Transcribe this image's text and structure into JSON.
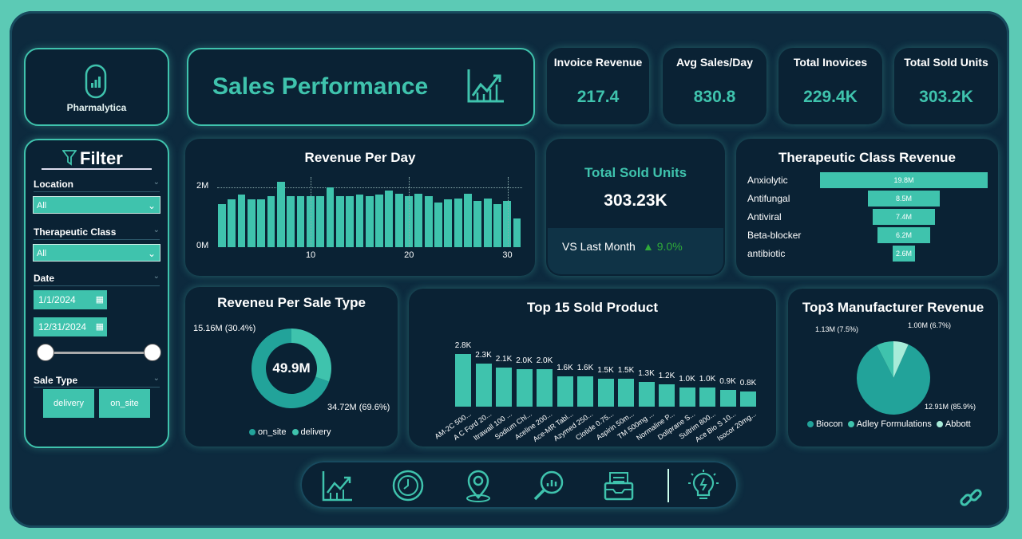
{
  "logo": {
    "name": "Pharmalytica"
  },
  "title": {
    "text": "Sales Performance"
  },
  "kpis": [
    {
      "label": "Invoice Revenue",
      "value": "217.4"
    },
    {
      "label": "Avg Sales/Day",
      "value": "830.8"
    },
    {
      "label": "Total Inovices",
      "value": "229.4K"
    },
    {
      "label": "Total Sold Units",
      "value": "303.2K"
    }
  ],
  "filter": {
    "title": "Filter",
    "location_label": "Location",
    "location_value": "All",
    "therapeutic_label": "Therapeutic Class",
    "therapeutic_value": "All",
    "date_label": "Date",
    "date_start": "1/1/2024",
    "date_end": "12/31/2024",
    "date_range_slider": {
      "start_fraction": 0,
      "end_fraction": 1
    },
    "sale_type_label": "Sale Type",
    "sale_type_options": [
      "delivery",
      "on_site"
    ]
  },
  "sold_units_card": {
    "title": "Total Sold Units",
    "value": "303.23K",
    "compare_label": "VS Last Month",
    "compare_value": "▲ 9.0%",
    "compare_color": "#2faa3a"
  },
  "colors": {
    "accent": "#3fc3ad",
    "background": "#0d2a3e",
    "panel": "#0a2234",
    "dark_teal": "#22a39a",
    "light_teal": "#a8ecd9"
  },
  "nav_icons": [
    "chart-trend-icon",
    "clock-icon",
    "location-pin-icon",
    "search-chart-icon",
    "inbox-icon",
    "lightbulb-icon"
  ],
  "link_icon": "link-icon",
  "chart_data": [
    {
      "type": "bar",
      "title": "Revenue Per Day",
      "x": [
        1,
        2,
        3,
        4,
        5,
        6,
        7,
        8,
        9,
        10,
        11,
        12,
        13,
        14,
        15,
        16,
        17,
        18,
        19,
        20,
        21,
        22,
        23,
        24,
        25,
        26,
        27,
        28,
        29,
        30,
        31
      ],
      "values": [
        1.45,
        1.6,
        1.75,
        1.6,
        1.6,
        1.72,
        2.2,
        1.7,
        1.7,
        1.7,
        1.7,
        2.0,
        1.7,
        1.7,
        1.75,
        1.7,
        1.75,
        1.9,
        1.8,
        1.7,
        1.8,
        1.7,
        1.5,
        1.6,
        1.62,
        1.8,
        1.55,
        1.62,
        1.45,
        1.55,
        0.95
      ],
      "yticks": [
        "0M",
        "2M"
      ],
      "yunits_max": 2,
      "xticks": [
        10,
        20,
        30
      ],
      "ylim": [
        0,
        2.4
      ]
    },
    {
      "type": "bar",
      "orientation": "horizontal",
      "title": "Therapeutic Class Revenue",
      "categories": [
        "Anxiolytic",
        "Antifungal",
        "Antiviral",
        "Beta-blocker",
        "antibiotic"
      ],
      "values": [
        19.8,
        8.5,
        7.4,
        6.2,
        2.6
      ],
      "labels": [
        "19.8M",
        "8.5M",
        "7.4M",
        "6.2M",
        "2.6M"
      ]
    },
    {
      "type": "pie",
      "subtype": "donut",
      "title": "Reveneu Per Sale Type",
      "center_label": "49.9M",
      "categories": [
        "on_site",
        "delivery"
      ],
      "values": [
        34.72,
        15.16
      ],
      "labels": [
        "34.72M (69.6%)",
        "15.16M (30.4%)"
      ],
      "colors": [
        "#22a39a",
        "#3fc3ad"
      ]
    },
    {
      "type": "bar",
      "title": "Top 15 Sold Product",
      "categories": [
        "AM-2C 500...",
        "A C Ford 20...",
        "Itrawall 100 ...",
        "Sodium Chl...",
        "Aceline 200...",
        "Ace-MR Tabl...",
        "Azymed 250...",
        "Clotide 0.75...",
        "Aspirin 50m...",
        "TM 500mg ...",
        "Normaline P...",
        "Doliprane S...",
        "Sultrim 800...",
        "Ace Bio S 10...",
        "Isocor 20mg..."
      ],
      "values": [
        2.8,
        2.3,
        2.1,
        2.0,
        2.0,
        1.6,
        1.6,
        1.5,
        1.5,
        1.3,
        1.2,
        1.0,
        1.0,
        0.9,
        0.8
      ],
      "labels": [
        "2.8K",
        "2.3K",
        "2.1K",
        "2.0K",
        "2.0K",
        "1.6K",
        "1.6K",
        "1.5K",
        "1.5K",
        "1.3K",
        "1.2K",
        "1.0K",
        "1.0K",
        "0.9K",
        "0.8K"
      ]
    },
    {
      "type": "pie",
      "title": "Top3 Manufacturer Revenue",
      "categories": [
        "Biocon",
        "Adley Formulations",
        "Abbott"
      ],
      "values": [
        12.91,
        1.13,
        1.0
      ],
      "labels": [
        "12.91M (85.9%)",
        "1.13M (7.5%)",
        "1.00M (6.7%)"
      ],
      "colors": [
        "#22a39a",
        "#3fc3ad",
        "#a8ecd9"
      ]
    }
  ]
}
